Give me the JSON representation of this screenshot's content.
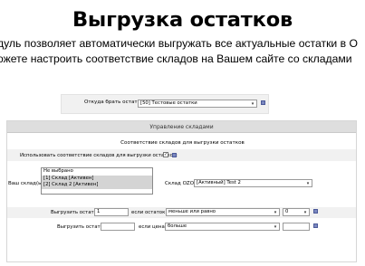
{
  "header": {
    "title": "Выгрузка остатков",
    "desc_line1": "дуль позволяет автоматически выгружать все актуальные остатки в О",
    "desc_line2": "ожете настроить соответствие складов на Вашем сайте со складами"
  },
  "source": {
    "label": "Откуда брать остатки:",
    "value": "[50] Тестовые остатки"
  },
  "warehouses": {
    "panel_title": "Управление складами",
    "subheading": "Соответствие складов для выгрузки остатков",
    "use_label": "Использовать соответствие складов для выгрузки остатков:",
    "use_checked": true,
    "your_label": "Ваш склад(ы):",
    "options": [
      "Не выбрано",
      "[1] Склад [Активен]",
      "[2] Склад 2 [Активен]"
    ],
    "selected_options": [
      1,
      2
    ],
    "ozon_label": "Склад OZON:",
    "ozon_value": "[Активный] Test 2"
  },
  "rule1": {
    "label": "Выгрузить остаток:",
    "value": "1",
    "if_label": "если остаток",
    "condition": "меньше или равно",
    "threshold": "0"
  },
  "rule2": {
    "label": "Выгрузить остаток:",
    "value": "",
    "if_label": "если цена",
    "condition": "больше",
    "threshold": ""
  },
  "colors": {
    "panel_header": "#dedede",
    "row_background": "#f1f1f1",
    "help_icon": "#7b88c0"
  }
}
